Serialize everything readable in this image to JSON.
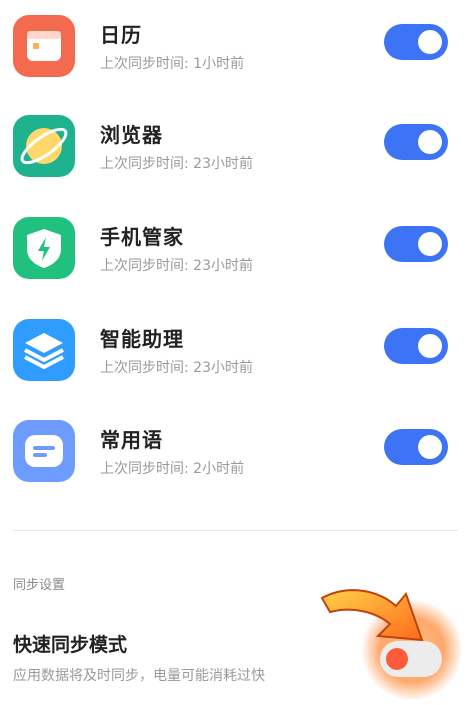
{
  "apps": [
    {
      "name": "日历",
      "sync": "上次同步时间: 1小时前",
      "enabled": true,
      "icon": "calendar-icon",
      "color": "#f46a4f"
    },
    {
      "name": "浏览器",
      "sync": "上次同步时间: 23小时前",
      "enabled": true,
      "icon": "browser-icon",
      "color": "#22b58f"
    },
    {
      "name": "手机管家",
      "sync": "上次同步时间: 23小时前",
      "enabled": true,
      "icon": "shield-icon",
      "color": "#21c07e"
    },
    {
      "name": "智能助理",
      "sync": "上次同步时间: 23小时前",
      "enabled": true,
      "icon": "layers-icon",
      "color": "#2f9cff"
    },
    {
      "name": "常用语",
      "sync": "上次同步时间: 2小时前",
      "enabled": true,
      "icon": "chat-icon",
      "color": "#6e9bff"
    }
  ],
  "settings": {
    "section_title": "同步设置",
    "fast_sync": {
      "title": "快速同步模式",
      "description": "应用数据将及时同步，电量可能消耗过快",
      "enabled": false
    }
  },
  "colors": {
    "toggle_on": "#3d73f5",
    "highlight": "#ff8a2a"
  }
}
